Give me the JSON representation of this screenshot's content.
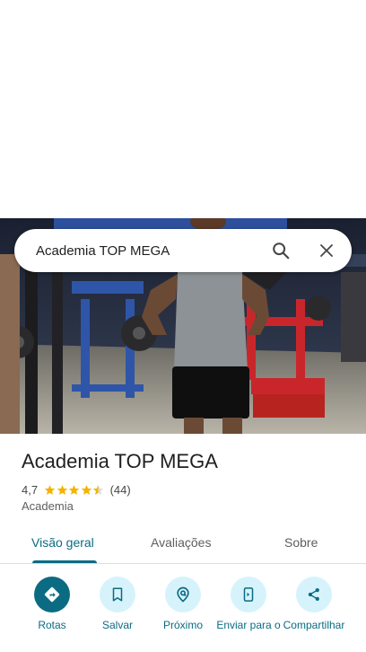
{
  "search": {
    "query": "Academia TOP MEGA"
  },
  "place": {
    "name": "Academia TOP MEGA",
    "rating": "4,7",
    "stars_filled": 4.5,
    "review_count": "(44)",
    "category": "Academia"
  },
  "tabs": [
    {
      "label": "Visão geral",
      "active": true
    },
    {
      "label": "Avaliações",
      "active": false
    },
    {
      "label": "Sobre",
      "active": false
    }
  ],
  "actions": [
    {
      "label": "Rotas",
      "icon": "directions-icon"
    },
    {
      "label": "Salvar",
      "icon": "bookmark-icon"
    },
    {
      "label": "Próximo",
      "icon": "nearby-icon"
    },
    {
      "label": "Enviar para o",
      "icon": "send-to-phone-icon"
    },
    {
      "label": "Compartilhar",
      "icon": "share-icon"
    }
  ],
  "colors": {
    "accent": "#0b6b82",
    "action_bg": "#d6f3fb",
    "star": "#f4b400"
  }
}
